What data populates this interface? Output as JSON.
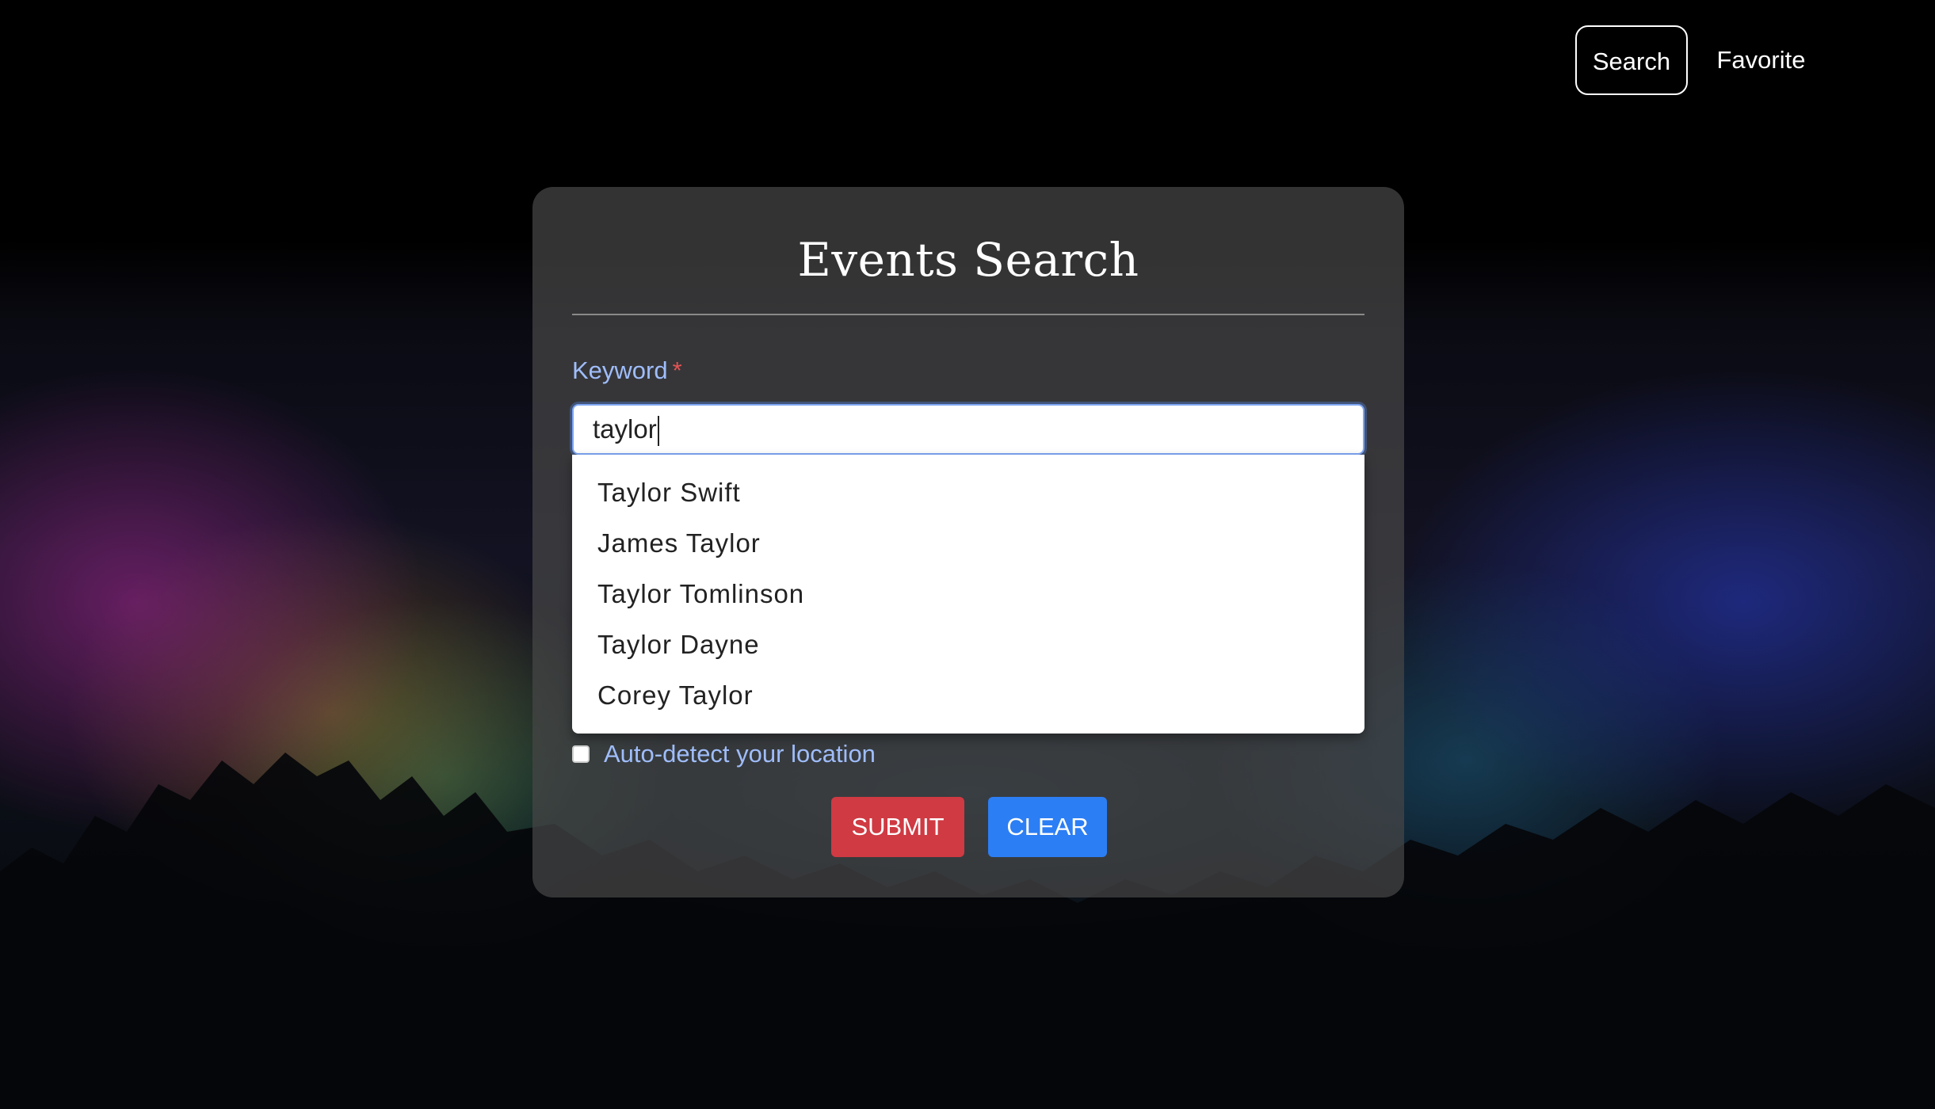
{
  "nav": {
    "search_label": "Search",
    "favorite_label": "Favorite"
  },
  "form": {
    "title": "Events Search",
    "keyword_label": "Keyword",
    "required_mark": "*",
    "keyword_value": "taylor",
    "suggestions": [
      "Taylor Swift",
      "James Taylor",
      "Taylor Tomlinson",
      "Taylor Dayne",
      "Corey Taylor"
    ],
    "autodetect_label": "Auto-detect your location",
    "autodetect_checked": false,
    "submit_label": "SUBMIT",
    "clear_label": "CLEAR"
  },
  "colors": {
    "label_blue": "#9fbdfb",
    "submit_red": "#cf3a43",
    "clear_blue": "#2c7ef4",
    "required_red": "#e55353"
  },
  "icons": {
    "background": "concert-crowd-image"
  }
}
